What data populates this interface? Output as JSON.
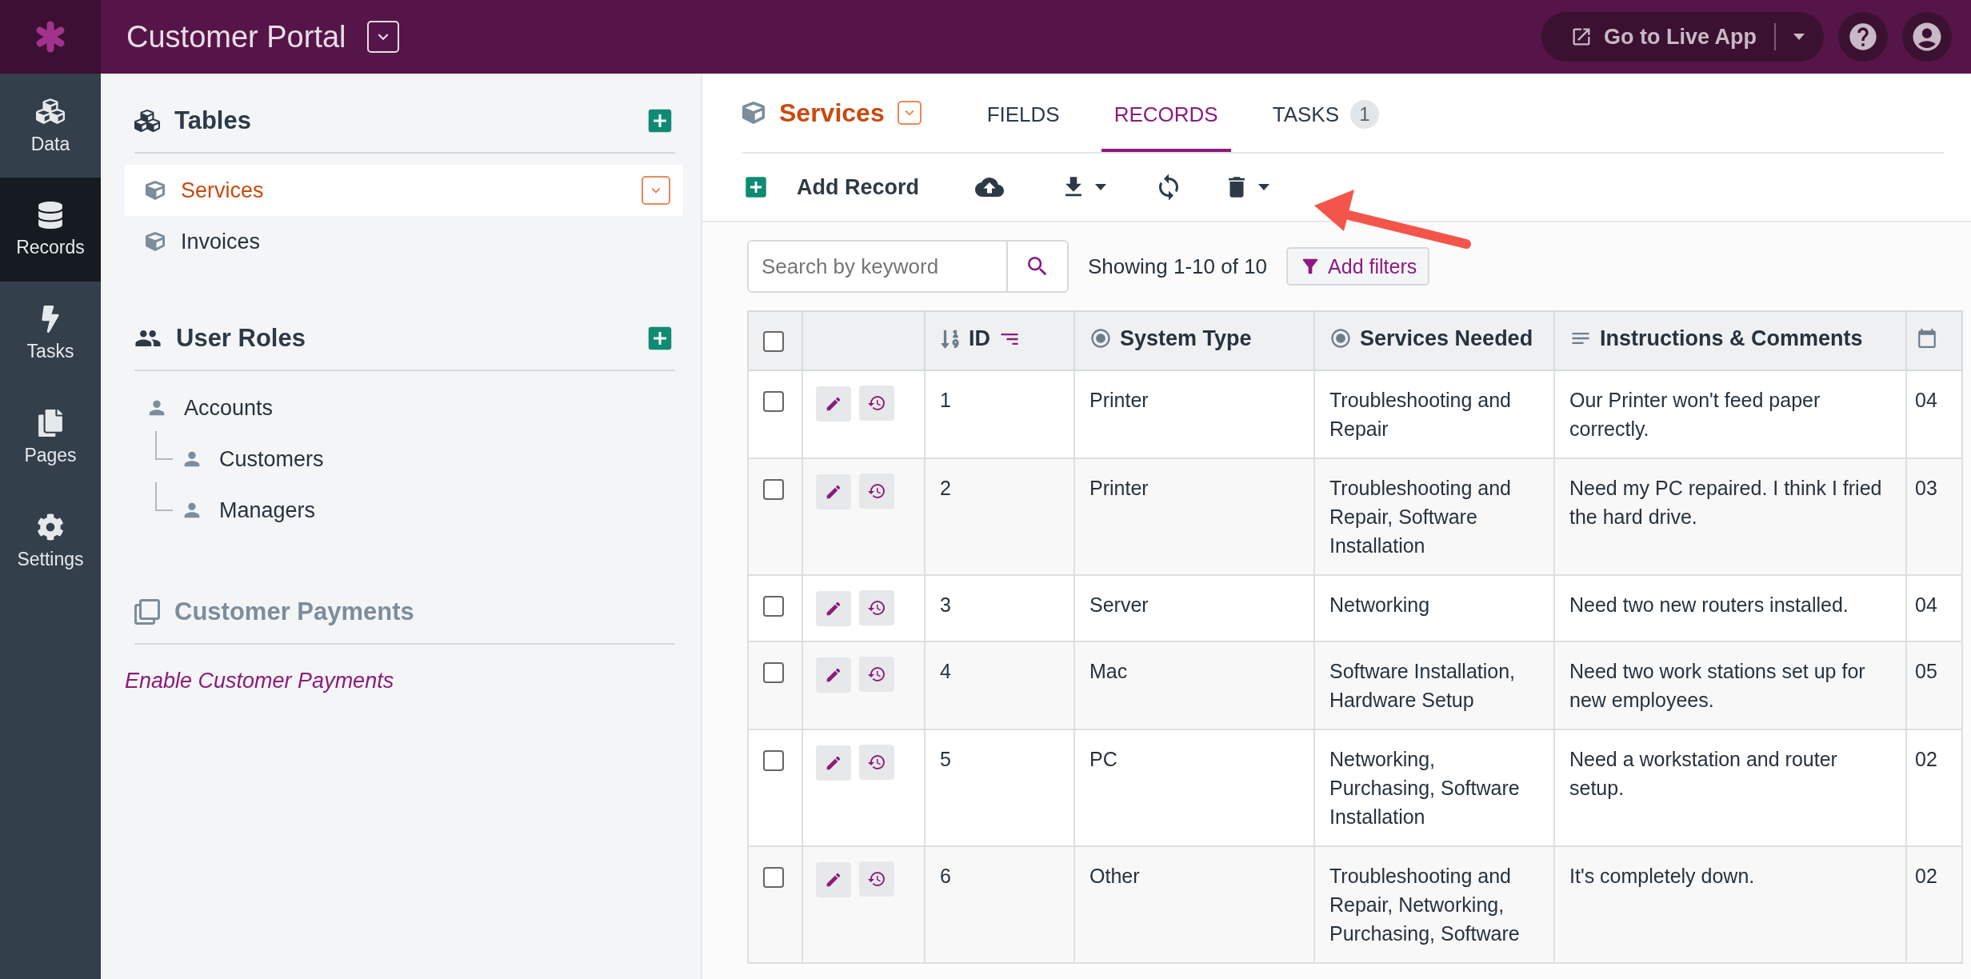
{
  "app": {
    "title": "Customer Portal"
  },
  "topbar": {
    "live_app_button": "Go to Live App"
  },
  "nav": [
    {
      "label": "Data",
      "kind": "data",
      "selected": false
    },
    {
      "label": "Records",
      "kind": "records",
      "selected": true
    },
    {
      "label": "Tasks",
      "kind": "tasks",
      "selected": false
    },
    {
      "label": "Pages",
      "kind": "pages",
      "selected": false
    },
    {
      "label": "Settings",
      "kind": "settings",
      "selected": false
    }
  ],
  "sidebar": {
    "sections": [
      {
        "title": "Tables",
        "kind": "tables",
        "items": [
          {
            "label": "Services",
            "selected": true
          },
          {
            "label": "Invoices",
            "selected": false
          }
        ]
      },
      {
        "title": "User Roles",
        "kind": "roles",
        "items": [
          {
            "label": "Accounts",
            "selected": false,
            "children": [
              {
                "label": "Customers",
                "selected": false
              },
              {
                "label": "Managers",
                "selected": false
              }
            ]
          }
        ]
      }
    ],
    "payments": {
      "title": "Customer Payments",
      "link": "Enable Customer Payments"
    }
  },
  "object": {
    "title": "Services",
    "tabs": [
      {
        "label": "FIELDS",
        "selected": false
      },
      {
        "label": "RECORDS",
        "selected": true
      },
      {
        "label": "TASKS",
        "selected": false,
        "badge": "1"
      }
    ]
  },
  "toolbar": {
    "add_record": "Add Record"
  },
  "search": {
    "placeholder": "Search by keyword"
  },
  "showing": "Showing 1-10 of 10",
  "filters_button": "Add filters",
  "table": {
    "header_checked": false,
    "columns": [
      {
        "kind": "id",
        "label": "ID"
      },
      {
        "kind": "choice",
        "label": "System Type"
      },
      {
        "kind": "choice",
        "label": "Services Needed"
      },
      {
        "kind": "text",
        "label": "Instructions & Comments"
      },
      {
        "kind": "date"
      }
    ],
    "rows": [
      {
        "checked": false,
        "cells": [
          "1",
          "Printer",
          "Troubleshooting and Repair",
          "Our Printer won't feed paper correctly.",
          "04"
        ]
      },
      {
        "checked": false,
        "cells": [
          "2",
          "Printer",
          "Troubleshooting and Repair, Software Installation",
          "Need my PC repaired. I think I fried the hard drive.",
          "03"
        ]
      },
      {
        "checked": false,
        "cells": [
          "3",
          "Server",
          "Networking",
          "Need two new routers installed.",
          "04"
        ]
      },
      {
        "checked": false,
        "cells": [
          "4",
          "Mac",
          "Software Installation, Hardware Setup",
          "Need two work stations set up for new employees.",
          "05"
        ]
      },
      {
        "checked": false,
        "cells": [
          "5",
          "PC",
          "Networking, Purchasing, Software Installation",
          "Need a workstation and router setup.",
          "02"
        ]
      },
      {
        "checked": false,
        "cells": [
          "6",
          "Other",
          "Troubleshooting and Repair, Networking, Purchasing, Software",
          "It's completely down.",
          "02"
        ]
      }
    ]
  }
}
